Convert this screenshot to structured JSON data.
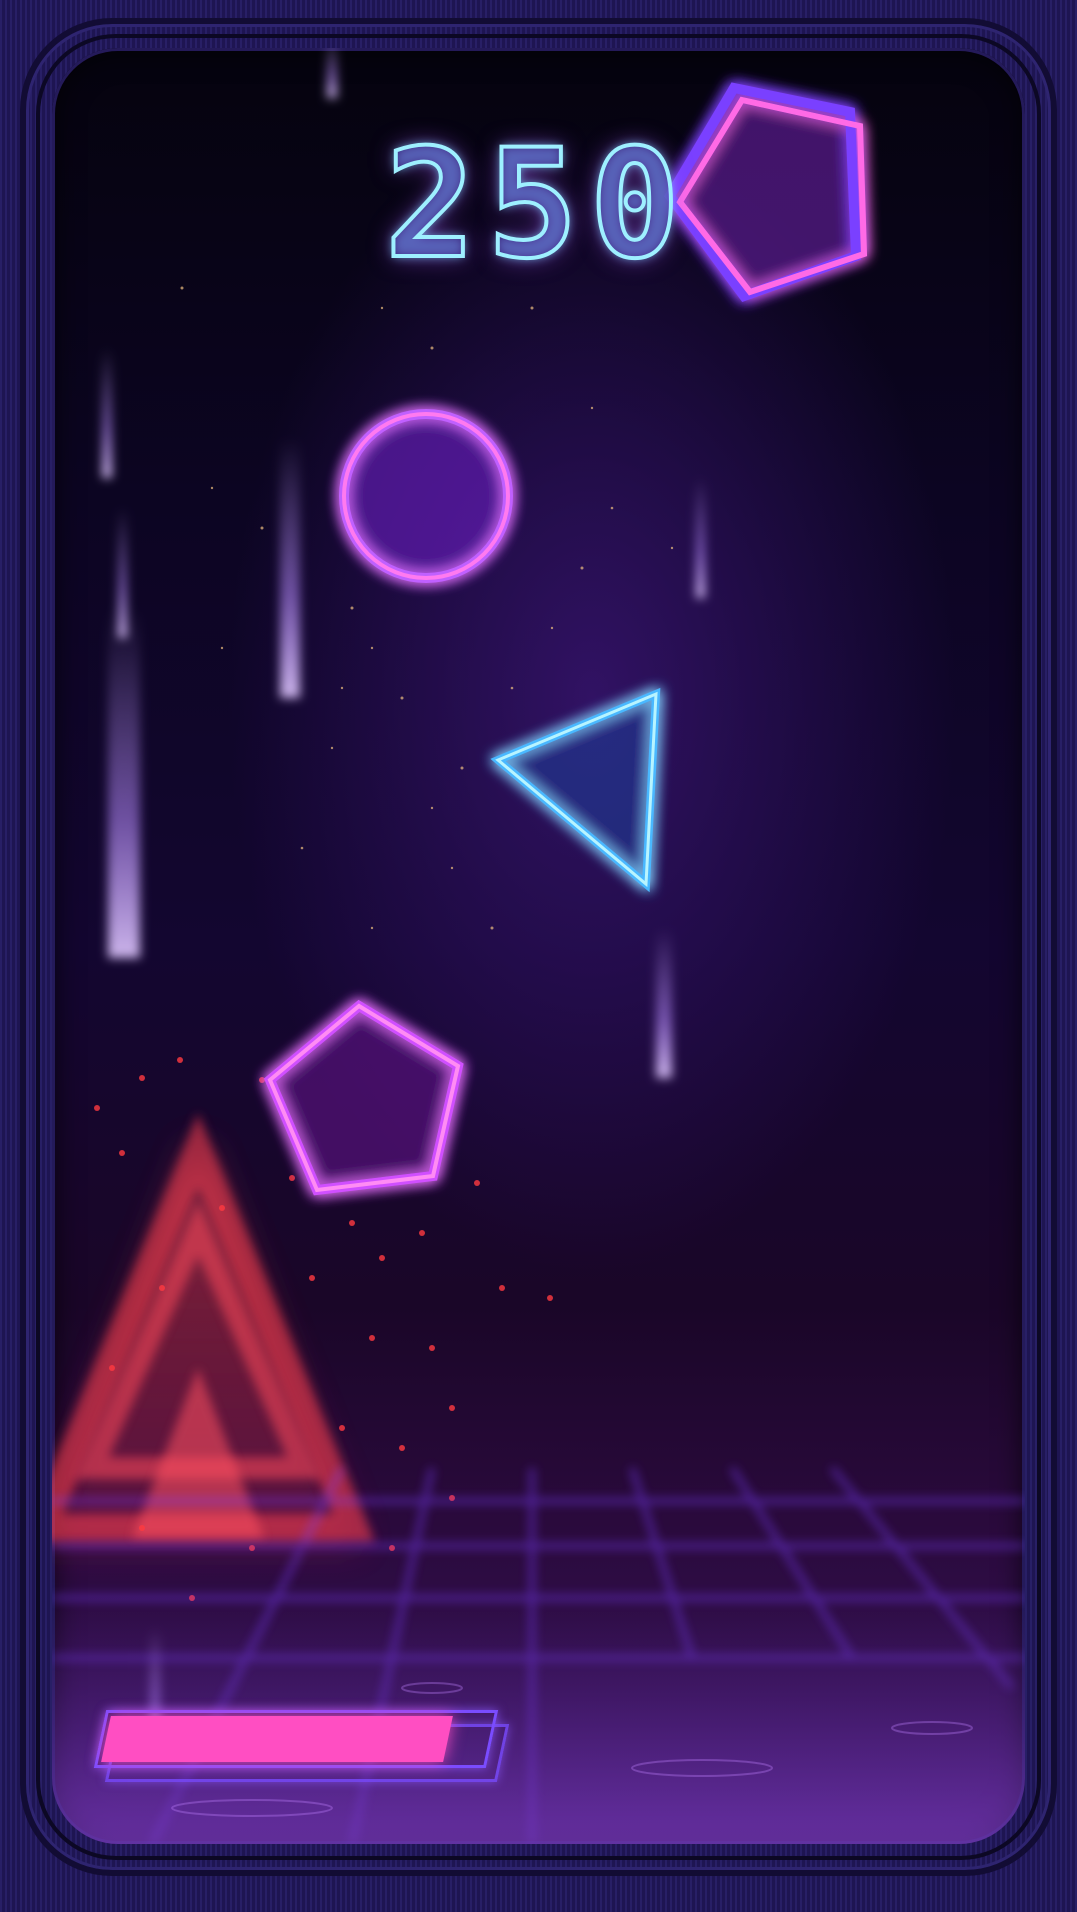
{
  "hud": {
    "score": "250",
    "health": 0.9
  },
  "colors": {
    "accent_pink": "#ff4ec2",
    "shape_magenta": "#ff6ae6",
    "shape_cyan": "#7ee8ff",
    "hazard_red": "#ff3b4e",
    "frame": "#1e1552"
  },
  "shapes": [
    {
      "kind": "pentagon",
      "color": "magenta"
    },
    {
      "kind": "circle",
      "color": "magenta"
    },
    {
      "kind": "triangle",
      "color": "cyan"
    },
    {
      "kind": "pentagon",
      "color": "magenta"
    }
  ]
}
